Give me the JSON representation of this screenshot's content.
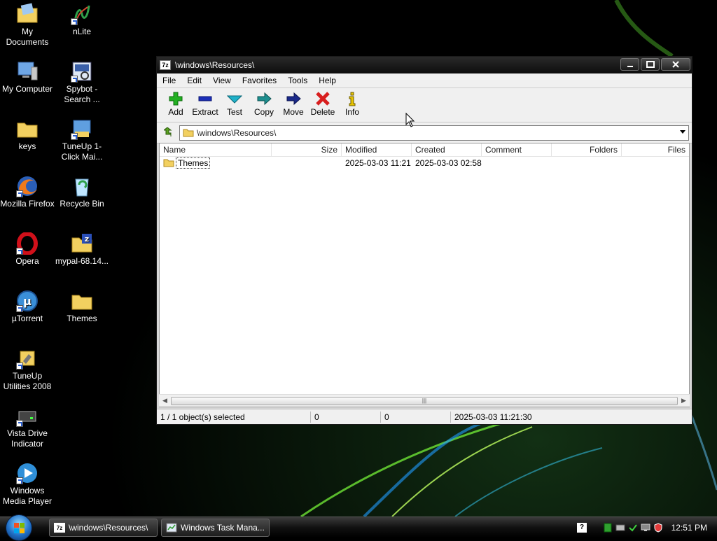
{
  "desktop": {
    "icons": [
      {
        "label": "My Documents"
      },
      {
        "label": "nLite"
      },
      {
        "label": "My Computer"
      },
      {
        "label": "Spybot - Search ..."
      },
      {
        "label": "keys"
      },
      {
        "label": "TuneUp 1-Click Mai..."
      },
      {
        "label": "Mozilla Firefox"
      },
      {
        "label": "Recycle Bin"
      },
      {
        "label": "Opera"
      },
      {
        "label": "mypal-68.14..."
      },
      {
        "label": "µTorrent"
      },
      {
        "label": "Themes"
      },
      {
        "label": "TuneUp Utilities 2008"
      },
      {
        "label": "Vista Drive Indicator"
      },
      {
        "label": "Windows Media Player"
      }
    ]
  },
  "window": {
    "app_icon_text": "7z",
    "title": "\\windows\\Resources\\",
    "menu": [
      "File",
      "Edit",
      "View",
      "Favorites",
      "Tools",
      "Help"
    ],
    "toolbar": [
      {
        "label": "Add",
        "icon": "plus-icon"
      },
      {
        "label": "Extract",
        "icon": "minus-icon"
      },
      {
        "label": "Test",
        "icon": "check-icon"
      },
      {
        "label": "Copy",
        "icon": "copy-arrow-icon"
      },
      {
        "label": "Move",
        "icon": "move-arrow-icon"
      },
      {
        "label": "Delete",
        "icon": "delete-x-icon"
      },
      {
        "label": "Info",
        "icon": "info-icon"
      }
    ],
    "address": "\\windows\\Resources\\",
    "columns": [
      "Name",
      "Size",
      "Modified",
      "Created",
      "Comment",
      "Folders",
      "Files"
    ],
    "rows": [
      {
        "name": "Themes",
        "size": "",
        "modified": "2025-03-03 11:21",
        "created": "2025-03-03 02:58",
        "comment": "",
        "folders": "",
        "files": ""
      }
    ],
    "status": {
      "selection": "1 / 1 object(s) selected",
      "size1": "0",
      "size2": "0",
      "modified": "2025-03-03 11:21:30"
    }
  },
  "taskbar": {
    "tasks": [
      {
        "label": "\\windows\\Resources\\",
        "icon_text": "7z"
      },
      {
        "label": "Windows Task Mana..."
      }
    ],
    "help_text": "?",
    "clock": "12:51 PM"
  },
  "colors": {
    "add_green": "#22b022",
    "extract_blue": "#1c2fb8",
    "test_cyan": "#1fb0c8",
    "copy_teal": "#1e8f8f",
    "move_navy": "#1b2a8a",
    "delete_red": "#d81e1e",
    "info_yellow": "#e8c400",
    "folder_yellow": "#f2d060"
  }
}
